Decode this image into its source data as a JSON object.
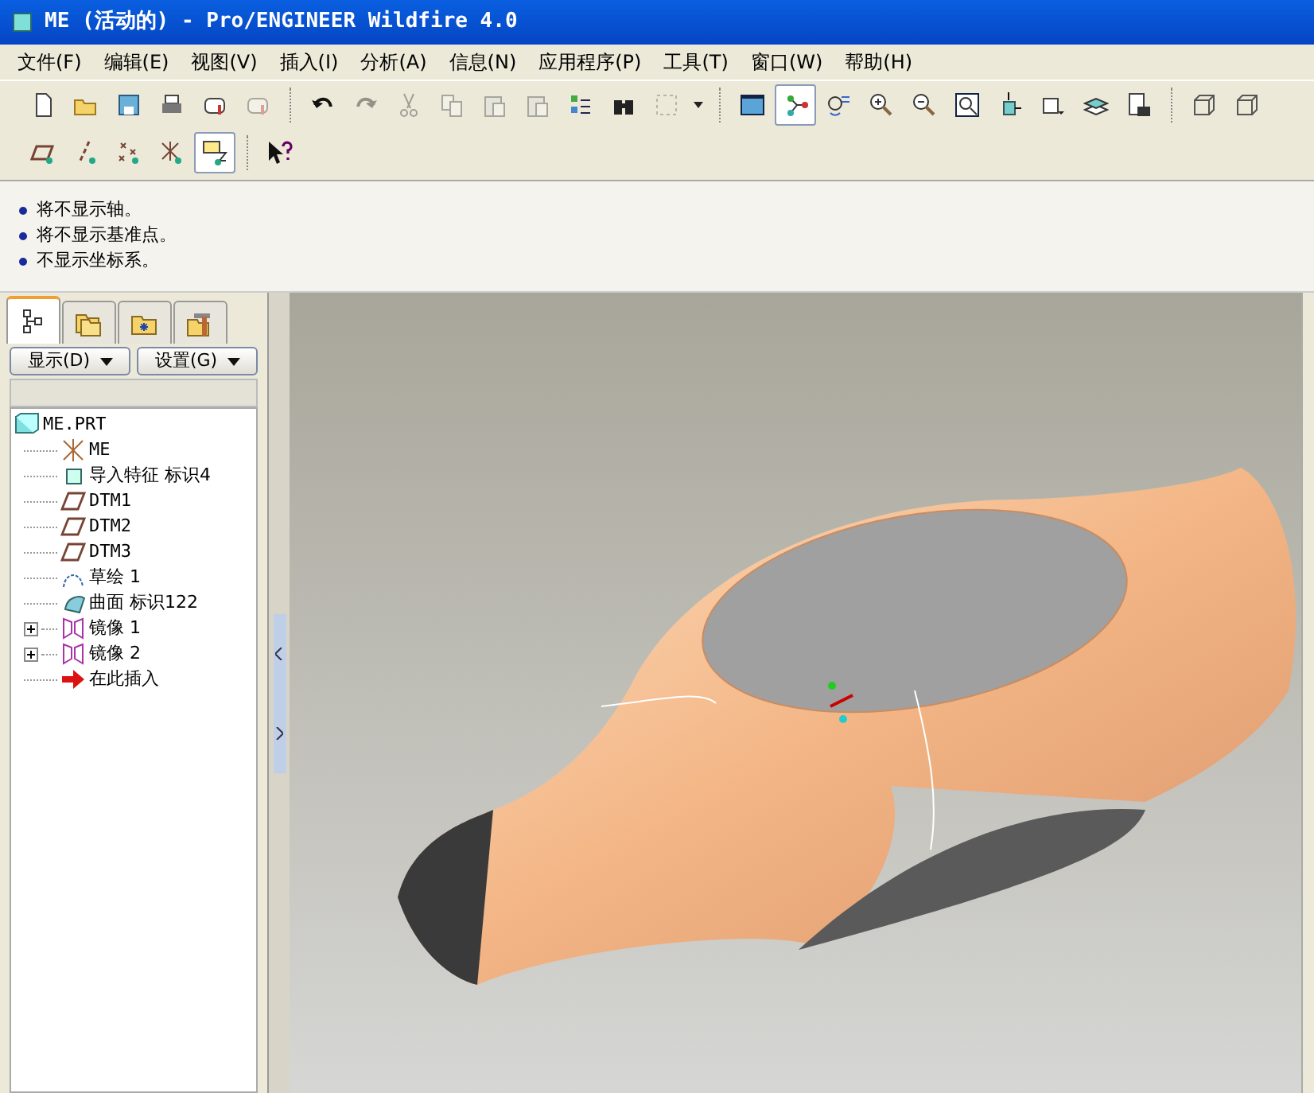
{
  "window": {
    "title": "ME (活动的) - Pro/ENGINEER Wildfire 4.0"
  },
  "menu": [
    "文件(F)",
    "编辑(E)",
    "视图(V)",
    "插入(I)",
    "分析(A)",
    "信息(N)",
    "应用程序(P)",
    "工具(T)",
    "窗口(W)",
    "帮助(H)"
  ],
  "toolbars": [
    {
      "groups": [
        [
          {
            "kind": "new",
            "pressed": false,
            "disabled": false
          },
          {
            "kind": "open",
            "pressed": false,
            "disabled": false
          },
          {
            "kind": "save",
            "pressed": false,
            "disabled": false
          },
          {
            "kind": "print",
            "pressed": false,
            "disabled": false
          },
          {
            "kind": "mail",
            "pressed": false,
            "disabled": false
          },
          {
            "kind": "mail",
            "pressed": false,
            "disabled": true
          }
        ],
        [
          {
            "kind": "undo",
            "pressed": false,
            "disabled": false
          },
          {
            "kind": "redo",
            "pressed": false,
            "disabled": true
          },
          {
            "kind": "cut",
            "pressed": false,
            "disabled": true
          },
          {
            "kind": "copy",
            "pressed": false,
            "disabled": true
          },
          {
            "kind": "paste",
            "pressed": false,
            "disabled": true
          },
          {
            "kind": "paste",
            "pressed": false,
            "disabled": true
          },
          {
            "kind": "regen",
            "pressed": false,
            "disabled": false
          },
          {
            "kind": "find",
            "pressed": false,
            "disabled": false
          },
          {
            "kind": "select",
            "pressed": false,
            "disabled": true
          },
          {
            "kind": "caret",
            "pressed": false,
            "disabled": false
          }
        ],
        [
          {
            "kind": "repaint",
            "pressed": false,
            "disabled": false
          },
          {
            "kind": "spin",
            "pressed": true,
            "disabled": false
          },
          {
            "kind": "orient",
            "pressed": false,
            "disabled": false
          },
          {
            "kind": "zoomin",
            "pressed": false,
            "disabled": false
          },
          {
            "kind": "zoomout",
            "pressed": false,
            "disabled": false
          },
          {
            "kind": "refit",
            "pressed": false,
            "disabled": false
          },
          {
            "kind": "reorient",
            "pressed": false,
            "disabled": false
          },
          {
            "kind": "views",
            "pressed": false,
            "disabled": false
          },
          {
            "kind": "layers",
            "pressed": false,
            "disabled": false
          },
          {
            "kind": "camera",
            "pressed": false,
            "disabled": false
          }
        ],
        [
          {
            "kind": "cube",
            "pressed": false,
            "disabled": false
          },
          {
            "kind": "cube",
            "pressed": false,
            "disabled": false
          }
        ]
      ]
    },
    {
      "groups": [
        [
          {
            "kind": "plane",
            "pressed": false,
            "disabled": false
          },
          {
            "kind": "axis",
            "pressed": false,
            "disabled": false
          },
          {
            "kind": "point",
            "pressed": false,
            "disabled": false
          },
          {
            "kind": "csys",
            "pressed": false,
            "disabled": false
          },
          {
            "kind": "note",
            "pressed": true,
            "disabled": false
          }
        ],
        [
          {
            "kind": "help",
            "pressed": false,
            "disabled": false
          }
        ]
      ]
    }
  ],
  "messages": [
    "将不显示轴。",
    "将不显示基准点。",
    "不显示坐标系。"
  ],
  "panel": {
    "tabs": [
      {
        "kind": "tree",
        "selected": true
      },
      {
        "kind": "folders",
        "selected": false
      },
      {
        "kind": "favorites",
        "selected": false
      },
      {
        "kind": "tools",
        "selected": false
      }
    ],
    "buttons": [
      "显示(D)",
      "设置(G)"
    ],
    "tree": [
      {
        "label": "ME.PRT",
        "kind": "part",
        "children": [
          {
            "label": "ME",
            "kind": "csys"
          },
          {
            "label": "导入特征 标识4",
            "kind": "import"
          },
          {
            "label": "DTM1",
            "kind": "plane"
          },
          {
            "label": "DTM2",
            "kind": "plane"
          },
          {
            "label": "DTM3",
            "kind": "plane"
          },
          {
            "label": "草绘 1",
            "kind": "sketch"
          },
          {
            "label": "曲面 标识122",
            "kind": "surface"
          },
          {
            "label": "镜像 1",
            "kind": "mirror",
            "expanded": false
          },
          {
            "label": "镜像 2",
            "kind": "mirror",
            "expanded": false
          },
          {
            "label": "在此插入",
            "kind": "insert"
          }
        ]
      }
    ]
  }
}
